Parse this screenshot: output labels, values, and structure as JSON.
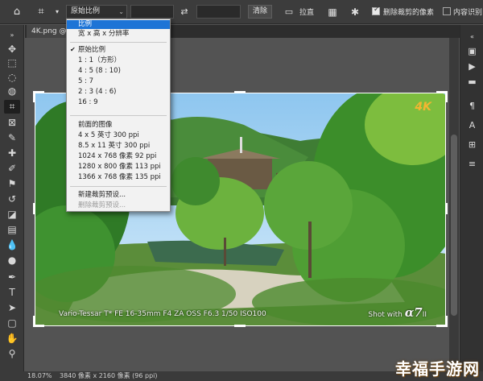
{
  "options_bar": {
    "ratio_value": "原始比例",
    "straighten_label": "拉直",
    "delete_cropped_label": "删除裁剪的像素",
    "content_aware_label": "内容识别",
    "clear_label": "清除"
  },
  "dropdown": {
    "items": [
      {
        "label": "比例",
        "highlighted": true
      },
      {
        "label": "宽 x 高 x 分辨率"
      },
      {
        "label": "原始比例",
        "checked": true
      },
      {
        "label": "1 : 1（方形）"
      },
      {
        "label": "4 : 5 (8 : 10)"
      },
      {
        "label": "5 : 7"
      },
      {
        "label": "2 : 3 (4 : 6)"
      },
      {
        "label": "16 : 9"
      },
      {
        "label": "前面的图像"
      },
      {
        "label": "4 x 5 英寸 300 ppi"
      },
      {
        "label": "8.5 x 11 英寸 300 ppi"
      },
      {
        "label": "1024 x 768 像素 92 ppi"
      },
      {
        "label": "1280 x 800 像素 113 ppi"
      },
      {
        "label": "1366 x 768 像素 135 ppi"
      },
      {
        "label": "新建裁剪预设..."
      },
      {
        "label": "删除裁剪预设...",
        "disabled": true
      }
    ]
  },
  "document_tab": {
    "title": "4K.png @ 1"
  },
  "photo": {
    "caption_left": "Vario-Tessar T* FE 16-35mm  F4 ZA OSS   F6.3  1/50  ISO100",
    "caption_right_prefix": "Shot with",
    "caption_right_brand": "α7",
    "caption_right_suffix": "II",
    "badge": "4K"
  },
  "status_bar": {
    "zoom": "18.07%",
    "dimensions": "3840 像素 x 2160 像素 (96 ppi)"
  },
  "watermark": "幸福手游网",
  "colors": {
    "highlight": "#1d74d6",
    "chrome_dark": "#3c3c3c",
    "canvas": "#535353",
    "badge": "#f3b531"
  }
}
